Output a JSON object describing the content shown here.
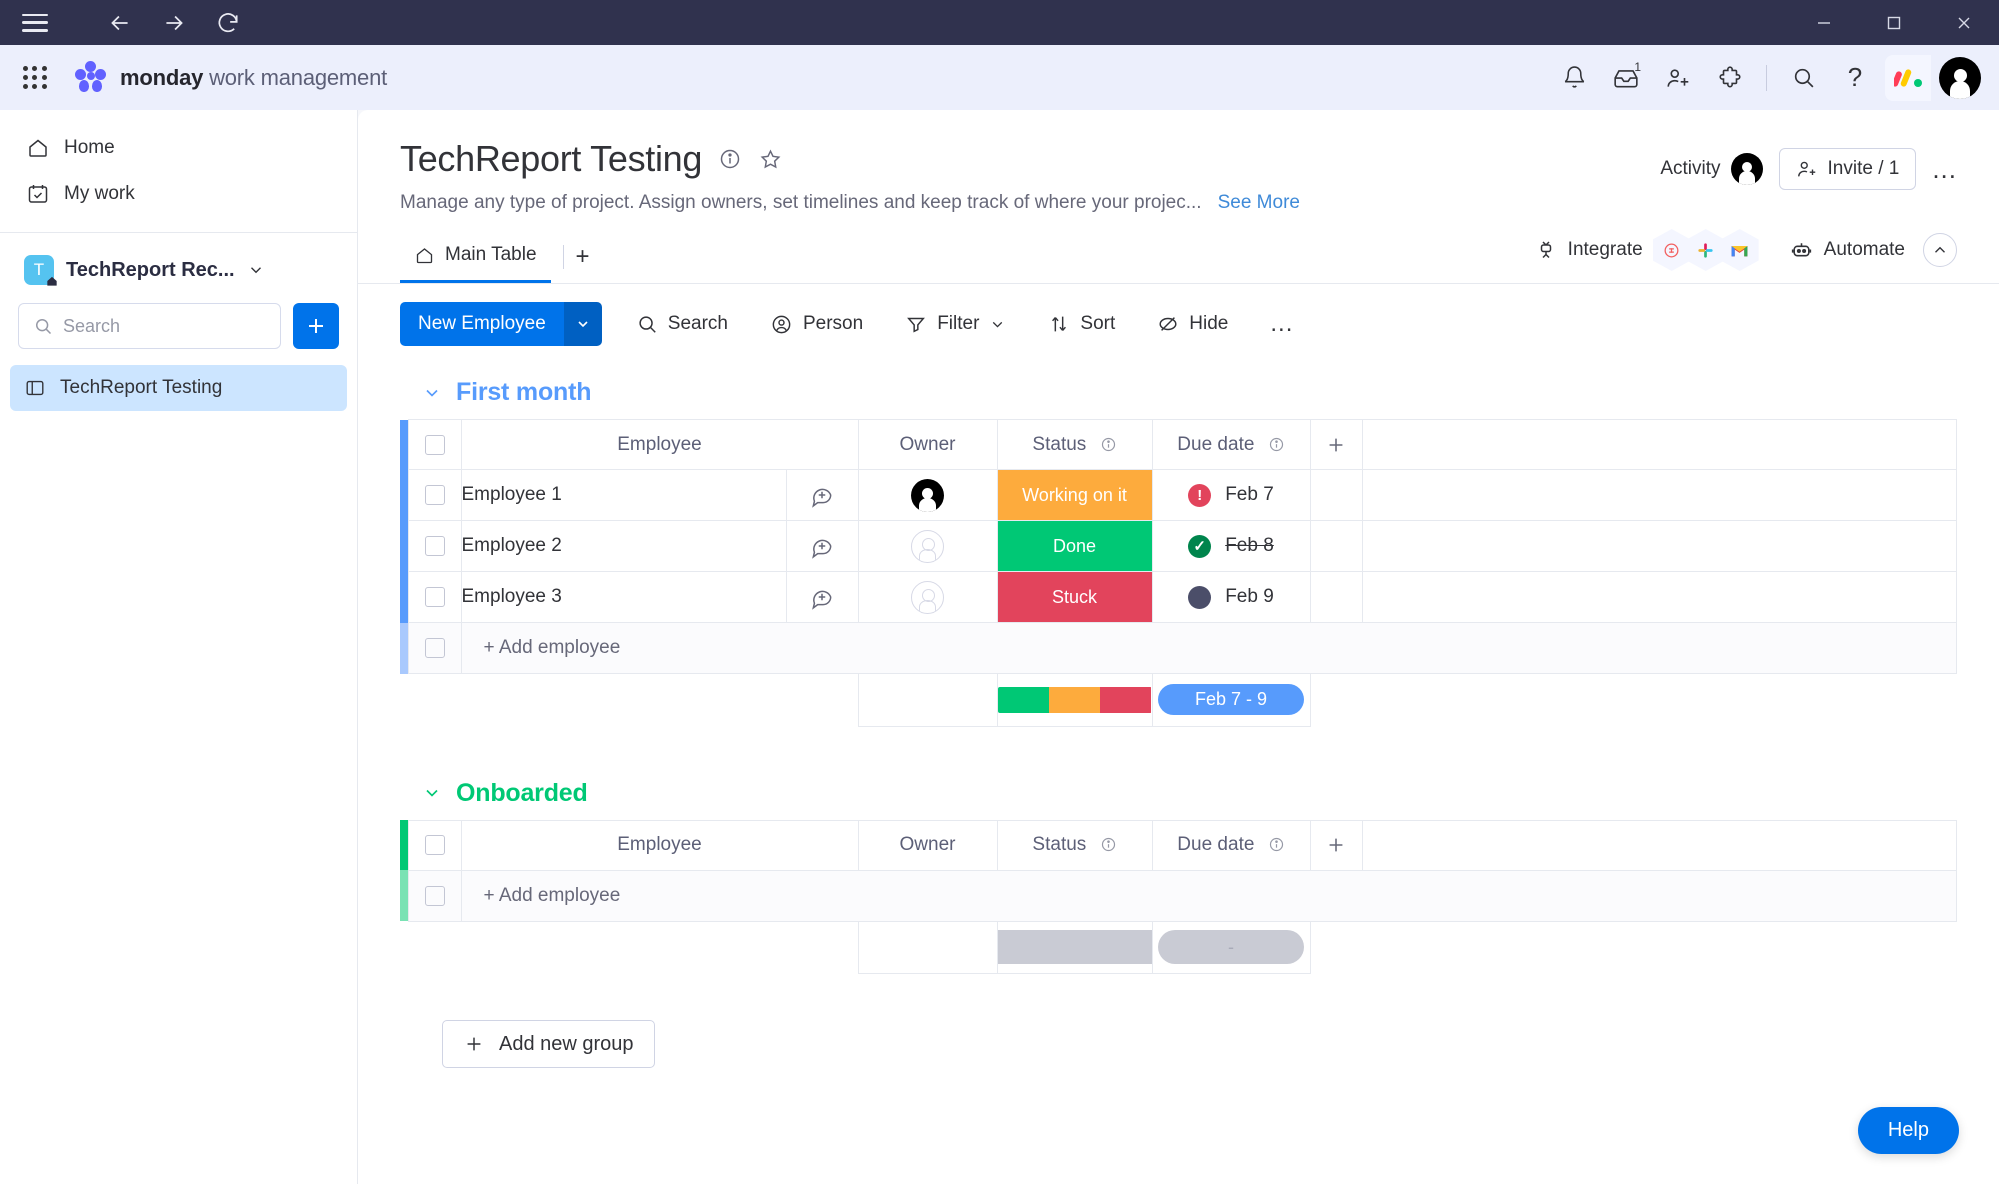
{
  "window": {
    "minimize_label": "Minimize",
    "maximize_label": "Maximize",
    "close_label": "Close",
    "nav_back": "Back",
    "nav_forward": "Forward",
    "nav_reload": "Reload"
  },
  "appbar": {
    "brand_bold": "monday",
    "brand_rest": " work management",
    "icons": [
      "notifications-bell",
      "inbox",
      "invite-members",
      "apps",
      "search",
      "help"
    ],
    "inbox_badge": "1"
  },
  "sidebar": {
    "items": [
      {
        "label": "Home",
        "icon": "home-icon"
      },
      {
        "label": "My work",
        "icon": "my-work-icon"
      }
    ],
    "workspace": {
      "initial": "T",
      "name": "TechReport Rec...",
      "avatar_color": "#55c3f0"
    },
    "search": {
      "placeholder": "Search",
      "value": ""
    },
    "add_button_label": "+",
    "boards": [
      {
        "label": "TechReport Testing",
        "selected": true
      }
    ]
  },
  "header": {
    "title": "TechReport Testing",
    "description": "Manage any type of project. Assign owners, set timelines and keep track of where your projec...",
    "see_more": "See More",
    "activity_label": "Activity",
    "invite_label": "Invite / 1",
    "more_label": "..."
  },
  "tabs": {
    "items": [
      {
        "label": "Main Table",
        "icon": "home-icon",
        "active": true
      }
    ],
    "add_label": "+",
    "integrate_label": "Integrate",
    "integrate_apps": [
      "mailchimp",
      "slack",
      "gmail"
    ],
    "automate_label": "Automate",
    "collapse_label": "Collapse"
  },
  "toolbar": {
    "new_item_label": "New Employee",
    "items": [
      {
        "label": "Search",
        "icon": "search-icon"
      },
      {
        "label": "Person",
        "icon": "person-icon"
      },
      {
        "label": "Filter",
        "icon": "filter-icon",
        "chevron": true
      },
      {
        "label": "Sort",
        "icon": "sort-icon"
      },
      {
        "label": "Hide",
        "icon": "hide-icon"
      }
    ],
    "more_label": "..."
  },
  "board": {
    "columns": [
      "Employee",
      "Owner",
      "Status",
      "Due date"
    ],
    "add_column_label": "+",
    "groups": [
      {
        "name": "First month",
        "color": "#579bfc",
        "rows": [
          {
            "name": "Employee 1",
            "owner": "assigned",
            "status": "Working on it",
            "status_color": "#fdab3d",
            "date": "Feb 7",
            "date_dot_color": "#e2445c",
            "date_dot_glyph": "!",
            "date_struck": false
          },
          {
            "name": "Employee 2",
            "owner": "empty",
            "status": "Done",
            "status_color": "#00c875",
            "date": "Feb 8",
            "date_dot_color": "#00854d",
            "date_dot_glyph": "✓",
            "date_struck": true
          },
          {
            "name": "Employee 3",
            "owner": "empty",
            "status": "Stuck",
            "status_color": "#e2445c",
            "date": "Feb 9",
            "date_dot_color": "#4b4e69",
            "date_dot_glyph": "",
            "date_struck": false
          }
        ],
        "add_row_label": "+ Add employee",
        "summary": {
          "status_segments": [
            {
              "color": "#00c875",
              "pct": 33.34
            },
            {
              "color": "#fdab3d",
              "pct": 33.33
            },
            {
              "color": "#e2445c",
              "pct": 33.33
            }
          ],
          "date_range": "Feb 7 - 9",
          "date_range_color": "#579bfc"
        }
      },
      {
        "name": "Onboarded",
        "color": "#00c875",
        "rows": [],
        "add_row_label": "+ Add employee",
        "summary": {
          "status_segments": [],
          "date_range": "-",
          "placeholder": true
        }
      }
    ],
    "add_group_label": "Add new group"
  },
  "help": {
    "label": "Help"
  }
}
